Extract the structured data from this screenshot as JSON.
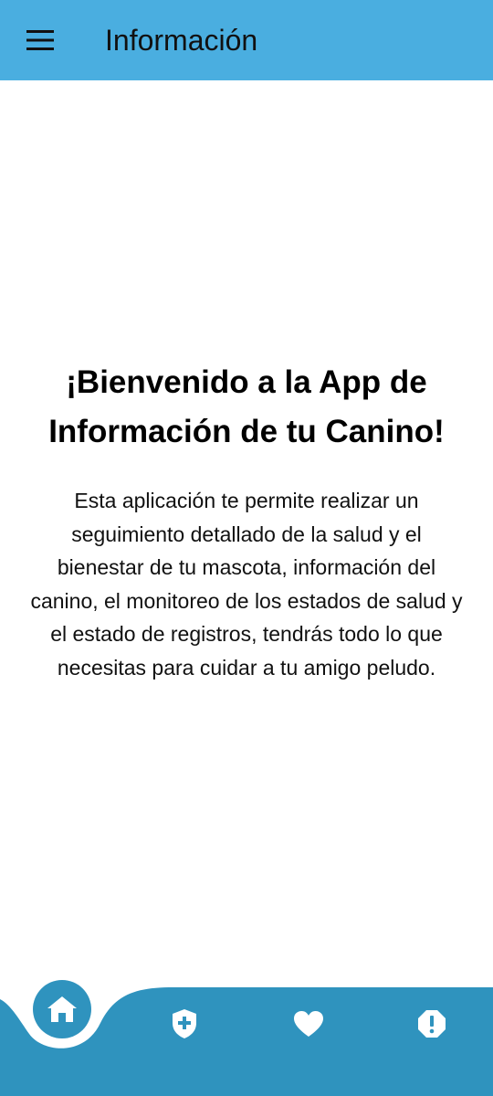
{
  "app_bar": {
    "title": "Información",
    "menu_icon": "hamburger-menu-icon",
    "background": "#4aaee0"
  },
  "main": {
    "heading": "¡Bienvenido a la App de Información de tu Canino!",
    "description": "Esta aplicación te permite realizar un seguimiento detallado de la salud y el bienestar de tu mascota, información del canino, el monitoreo de los estados de salud y el estado de registros, tendrás todo lo que necesitas para cuidar a tu amigo peludo."
  },
  "bottom_nav": {
    "background": "#2f93be",
    "selected": "home",
    "items": [
      {
        "id": "home",
        "icon": "home-icon"
      },
      {
        "id": "health",
        "icon": "shield-plus-icon"
      },
      {
        "id": "wellness",
        "icon": "heart-icon"
      },
      {
        "id": "alerts",
        "icon": "alert-octagon-icon"
      }
    ]
  }
}
